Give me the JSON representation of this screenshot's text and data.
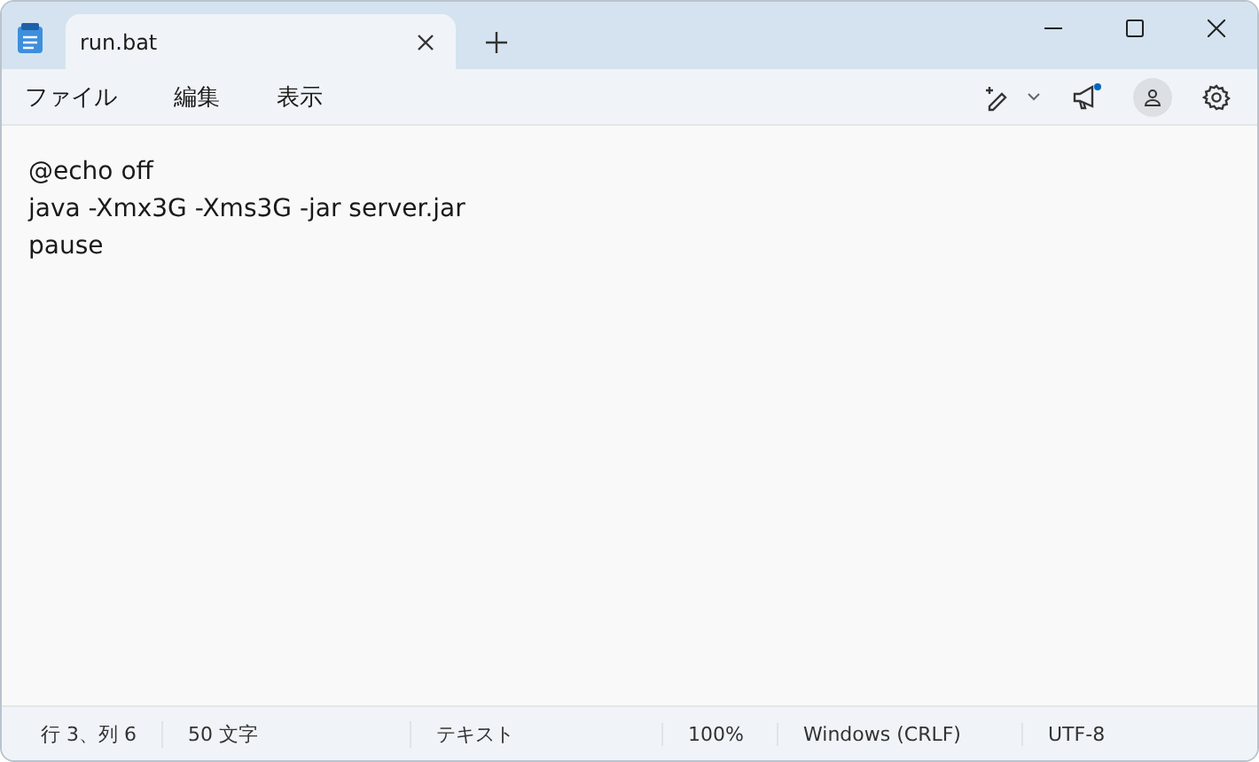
{
  "tabs": [
    {
      "label": "run.bat",
      "selected": true
    }
  ],
  "menu": [
    "ファイル",
    "編集",
    "表示"
  ],
  "editor": {
    "lines": [
      "@echo off",
      "java -Xmx3G -Xms3G -jar server.jar",
      "pause"
    ]
  },
  "notification": {
    "unread": true
  },
  "status_bar": [
    "行 3、列 6",
    "50 文字",
    "テキスト",
    "100%",
    "Windows (CRLF)",
    "UTF-8"
  ]
}
